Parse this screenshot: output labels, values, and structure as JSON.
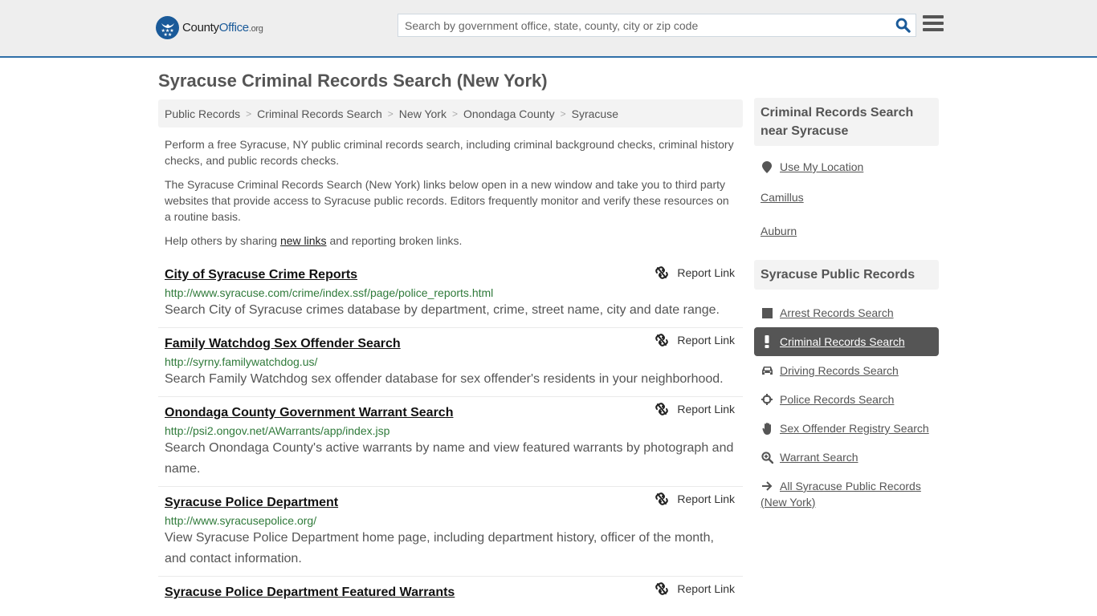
{
  "header": {
    "logo": {
      "name_part1": "County",
      "name_part2": "Office",
      "name_part3": ".org"
    },
    "search": {
      "placeholder": "Search by government office, state, county, city or zip code",
      "value": ""
    },
    "brand_color": "#1a5a99"
  },
  "page": {
    "title": "Syracuse Criminal Records Search (New York)"
  },
  "breadcrumb": [
    {
      "label": "Public Records"
    },
    {
      "label": "Criminal Records Search"
    },
    {
      "label": "New York"
    },
    {
      "label": "Onondaga County"
    },
    {
      "label": "Syracuse"
    }
  ],
  "intro": {
    "p1": "Perform a free Syracuse, NY public criminal records search, including criminal background checks, criminal history checks, and public records checks.",
    "p2": "The Syracuse Criminal Records Search (New York) links below open in a new window and take you to third party websites that provide access to Syracuse public records. Editors frequently monitor and verify these resources on a routine basis.",
    "p3_before": "Help others by sharing ",
    "p3_link": "new links",
    "p3_after": " and reporting broken links."
  },
  "results": [
    {
      "title": "City of Syracuse Crime Reports",
      "url": "http://www.syracuse.com/crime/index.ssf/page/police_reports.html",
      "description": "Search City of Syracuse crimes database by department, crime, street name, city and date range.",
      "report_label": "Report Link"
    },
    {
      "title": "Family Watchdog Sex Offender Search",
      "url": "http://syrny.familywatchdog.us/",
      "description": "Search Family Watchdog sex offender database for sex offender's residents in your neighborhood.",
      "report_label": "Report Link"
    },
    {
      "title": "Onondaga County Government Warrant Search",
      "url": "http://psi2.ongov.net/AWarrants/app/index.jsp",
      "description": "Search Onondaga County's active warrants by name and view featured warrants by photograph and name.",
      "report_label": "Report Link"
    },
    {
      "title": "Syracuse Police Department",
      "url": "http://www.syracusepolice.org/",
      "description": "View Syracuse Police Department home page, including department history, officer of the month, and contact information.",
      "report_label": "Report Link"
    },
    {
      "title": "Syracuse Police Department Featured Warrants",
      "url": "",
      "description": "",
      "report_label": "Report Link"
    }
  ],
  "sidebar": {
    "nearby": {
      "heading": "Criminal Records Search near Syracuse",
      "use_location": "Use My Location",
      "places": [
        "Camillus",
        "Auburn"
      ]
    },
    "public_records": {
      "heading": "Syracuse Public Records",
      "items": [
        {
          "label": "Arrest Records Search",
          "icon": "square-icon",
          "active": false
        },
        {
          "label": "Criminal Records Search",
          "icon": "exclamation-icon",
          "active": true
        },
        {
          "label": "Driving Records Search",
          "icon": "car-icon",
          "active": false
        },
        {
          "label": "Police Records Search",
          "icon": "crosshairs-icon",
          "active": false
        },
        {
          "label": "Sex Offender Registry Search",
          "icon": "hand-icon",
          "active": false
        },
        {
          "label": "Warrant Search",
          "icon": "zoom-in-icon",
          "active": false
        },
        {
          "label": "All Syracuse Public Records (New York)",
          "icon": "arrow-right-icon",
          "active": false
        }
      ]
    }
  }
}
